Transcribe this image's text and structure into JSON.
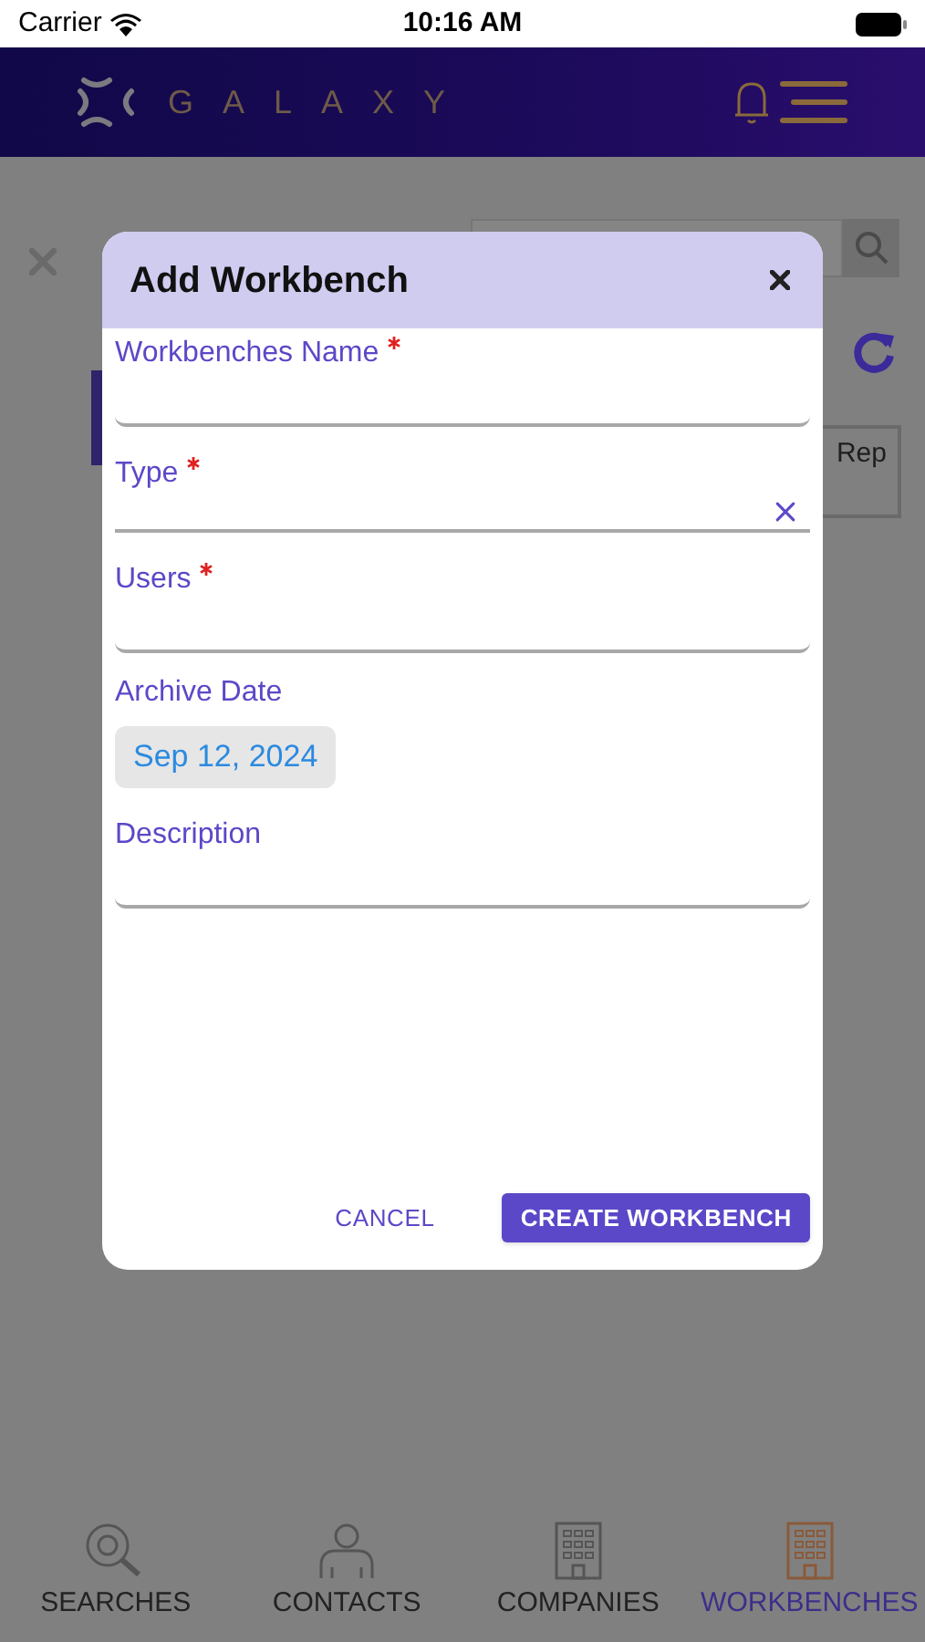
{
  "status_bar": {
    "carrier": "Carrier",
    "time": "10:16 AM"
  },
  "header": {
    "logo_text": "GALAXY"
  },
  "background": {
    "button_text": "Rep"
  },
  "dialog": {
    "title": "Add Workbench",
    "fields": [
      {
        "kind": "text",
        "label": "Workbenches Name",
        "required": true
      },
      {
        "kind": "select",
        "label": "Type",
        "required": true
      },
      {
        "kind": "text",
        "label": "Users",
        "required": true
      },
      {
        "kind": "date",
        "label": "Archive Date",
        "required": false,
        "value": "Sep 12, 2024"
      },
      {
        "kind": "text",
        "label": "Description",
        "required": false
      }
    ],
    "cancel": "CANCEL",
    "submit": "CREATE WORKBENCH"
  },
  "tabs": [
    {
      "label": "SEARCHES",
      "kind": "search",
      "selected": false
    },
    {
      "label": "CONTACTS",
      "kind": "person",
      "selected": false
    },
    {
      "label": "COMPANIES",
      "kind": "building",
      "selected": false
    },
    {
      "label": "WORKBENCHES",
      "kind": "building",
      "selected": true
    }
  ]
}
